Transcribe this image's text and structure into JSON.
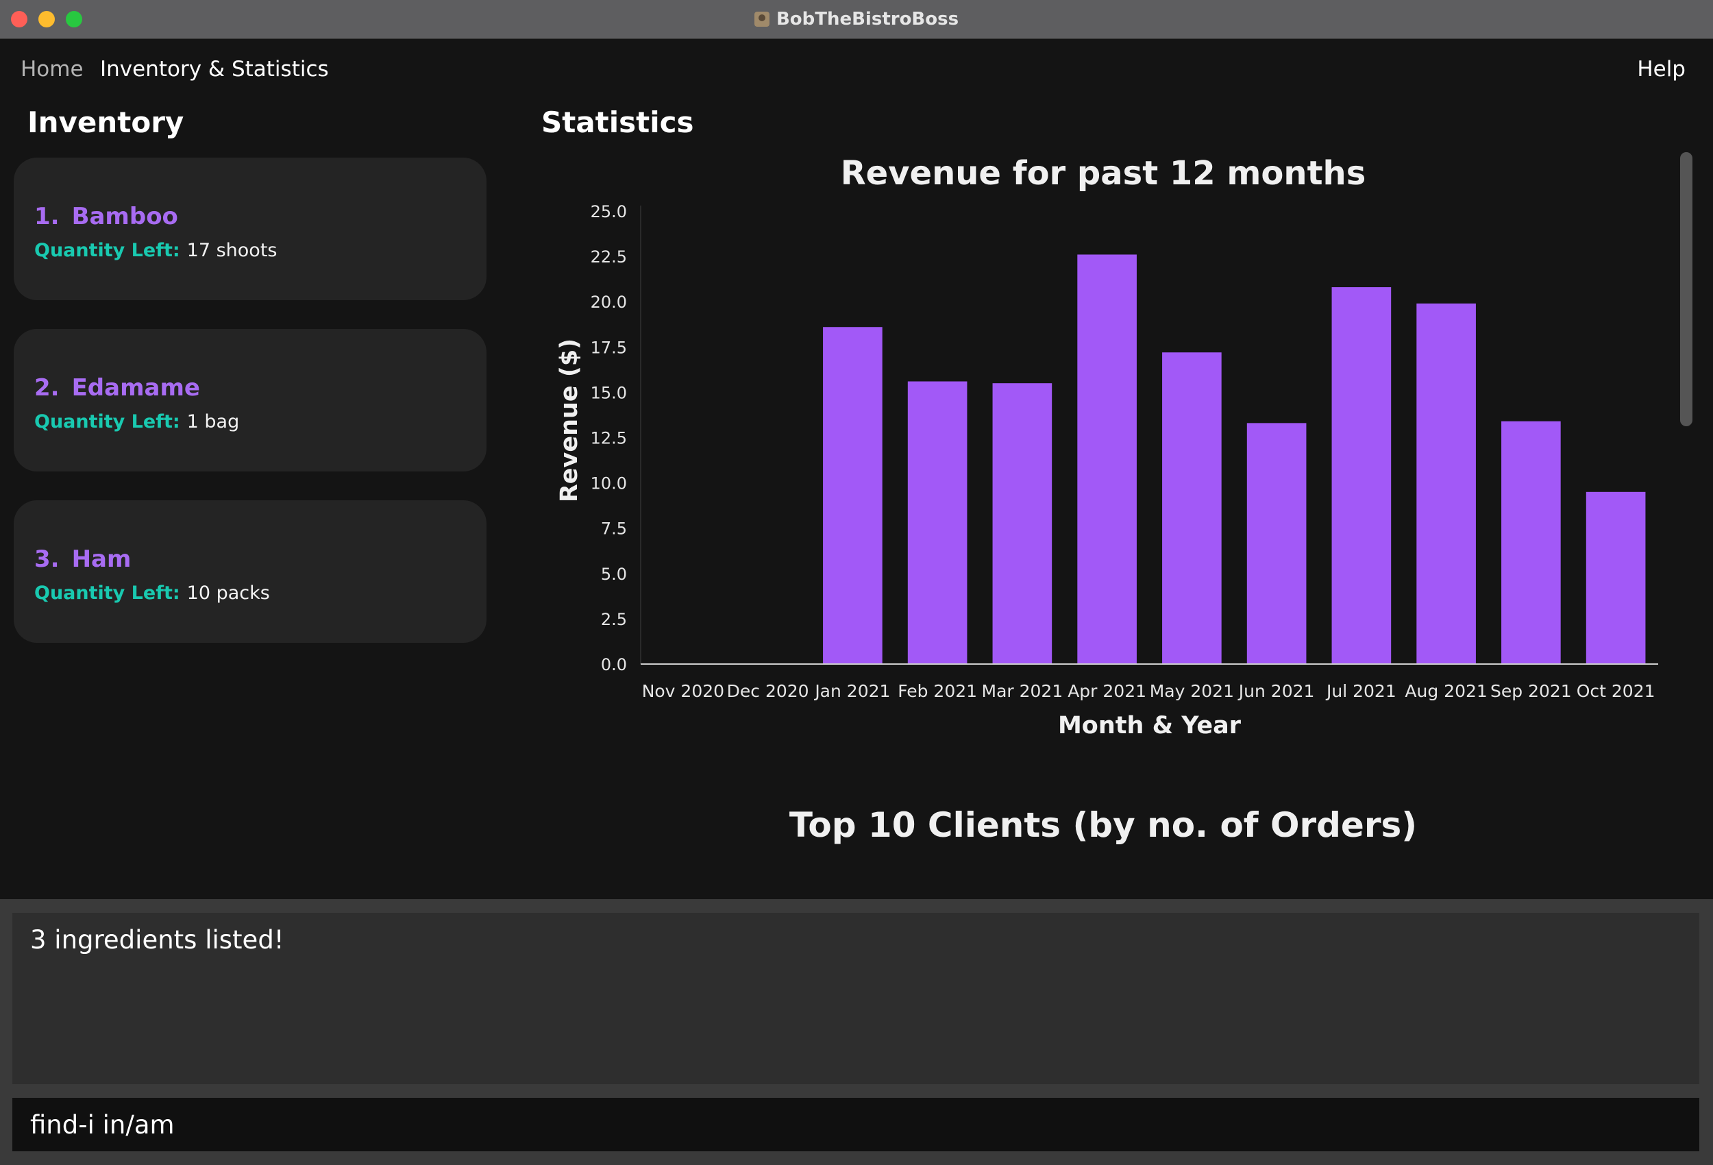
{
  "window": {
    "title": "BobTheBistroBoss"
  },
  "menu": {
    "home": "Home",
    "inventory_stats": "Inventory & Statistics",
    "help": "Help"
  },
  "inventory": {
    "title": "Inventory",
    "qty_label": "Quantity Left:",
    "items": [
      {
        "num": "1.",
        "name": "Bamboo",
        "quantity": "17 shoots"
      },
      {
        "num": "2.",
        "name": "Edamame",
        "quantity": "1 bag"
      },
      {
        "num": "3.",
        "name": "Ham",
        "quantity": "10 packs"
      }
    ]
  },
  "statistics": {
    "title": "Statistics",
    "second_chart_title": "Top 10 Clients (by no. of Orders)"
  },
  "chart_data": {
    "type": "bar",
    "title": "Revenue for past 12 months",
    "xlabel": "Month & Year",
    "ylabel": "Revenue ($)",
    "ylim": [
      0,
      25
    ],
    "yticks": [
      "0.0",
      "2.5",
      "5.0",
      "7.5",
      "10.0",
      "12.5",
      "15.0",
      "17.5",
      "20.0",
      "22.5",
      "25.0"
    ],
    "grid": false,
    "bar_color": "#a259f7",
    "categories": [
      "Nov 2020",
      "Dec 2020",
      "Jan 2021",
      "Feb 2021",
      "Mar 2021",
      "Apr 2021",
      "May 2021",
      "Jun 2021",
      "Jul 2021",
      "Aug 2021",
      "Sep 2021",
      "Oct 2021"
    ],
    "values": [
      0,
      0,
      18.6,
      15.6,
      15.5,
      22.6,
      17.2,
      13.3,
      20.8,
      19.9,
      13.4,
      9.5
    ]
  },
  "result_display": {
    "text": "3 ingredients listed!"
  },
  "command_box": {
    "value": "find-i in/am"
  },
  "colors": {
    "accent_purple": "#a86cf2",
    "label_teal": "#19c9b0",
    "bar_purple": "#a259f7"
  }
}
